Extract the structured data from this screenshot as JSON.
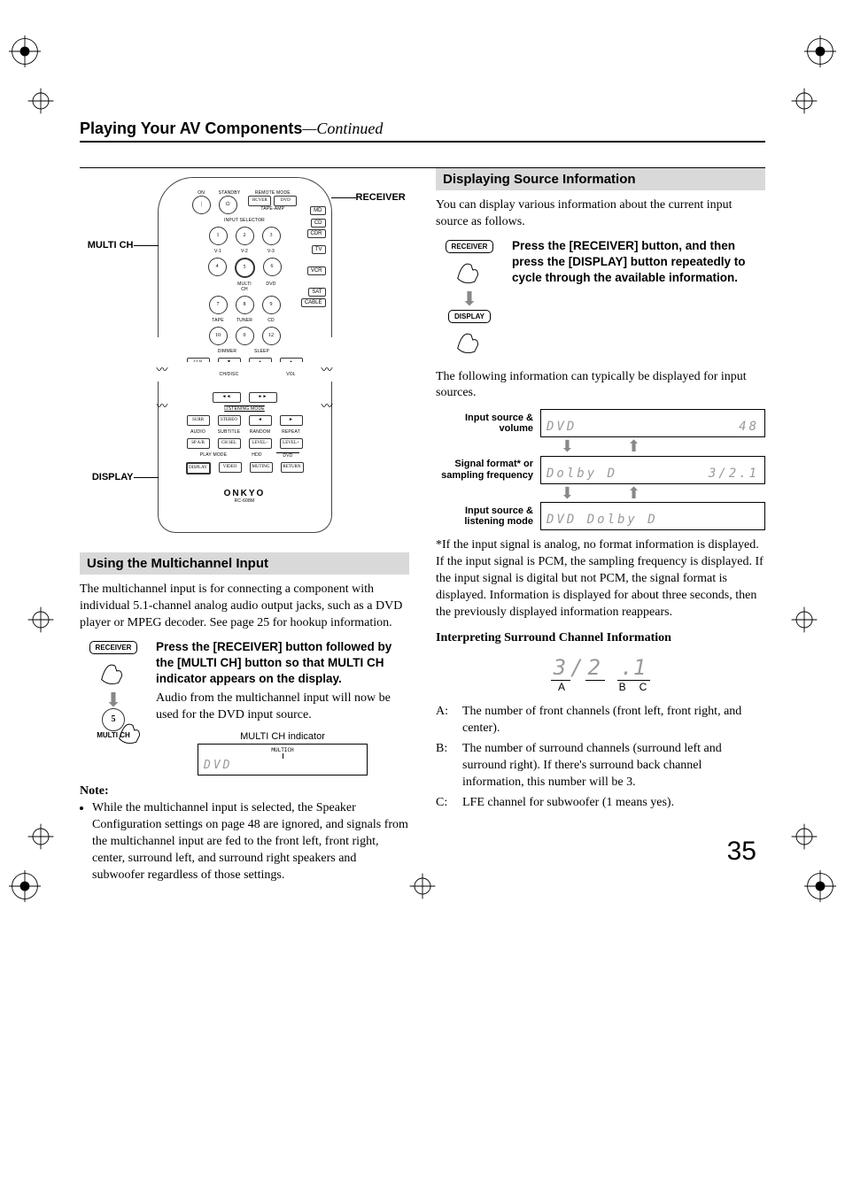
{
  "header": {
    "title": "Playing Your AV Components",
    "continued": "—Continued"
  },
  "remote": {
    "label_multich": "MULTI CH",
    "label_display": "DISPLAY",
    "label_receiver": "RECEIVER",
    "rows": {
      "on": "ON",
      "standby": "STANDBY",
      "remote_mode": "REMOTE MODE",
      "tape_amp": "TAPE-AMP",
      "input_selector": "INPUT SELECTOR",
      "v1": "V-1",
      "v2": "V-2",
      "v3": "V-3",
      "multich": "MULTI CH",
      "dvd": "DVD",
      "tape": "TAPE",
      "tuner": "TUNER",
      "cd": "CD",
      "n1": "1",
      "n2": "2",
      "n3": "3",
      "n4": "4",
      "n5": "5",
      "n6": "6",
      "n7": "7",
      "n8": "8",
      "n9": "9",
      "n10": "10",
      "n0": "0",
      "n12": "12",
      "dimmer": "DIMMER",
      "sleep": "SLEEP",
      "clr": "CLR",
      "chdsk": "CH/DISC",
      "vol": "VOL",
      "listening": "LISTENING MODE",
      "surr": "SURR",
      "stereo": "STEREO",
      "audio": "AUDIO",
      "subtitle": "SUBTITLE",
      "random": "RANDOM",
      "repeat": "REPEAT",
      "spab": "SP A/B",
      "chsel": "CH SEL",
      "level_m": "LEVEL–",
      "level_p": "LEVEL+",
      "playmode": "PLAY MODE",
      "hdd": "HDD",
      "dvd2": "DVD",
      "display_b": "DISPLAY",
      "video": "VIDEO",
      "muting": "MUTING",
      "return": "RETURN",
      "brand": "ONKYO",
      "model": "RC-608M"
    },
    "side": {
      "md": "MD",
      "cd": "CD",
      "cdr": "CDR",
      "tv": "TV",
      "vcr": "VCR",
      "sat": "SAT",
      "cable": "CABLE",
      "rcver": "RCVER",
      "dvd": "DVD"
    }
  },
  "left": {
    "heading": "Using the Multichannel Input",
    "p1": "The multichannel input is for connecting a component with individual 5.1-channel analog audio output jacks, such as a DVD player or MPEG decoder. See page 25 for hookup information.",
    "step_bold": "Press the [RECEIVER] button followed by the [MULTI CH] button so that MULTI CH indicator appears on the display.",
    "step_text": "Audio from the multichannel input will now be used for the DVD input source.",
    "indicator_label": "MULTI CH indicator",
    "lcd_small": "MULTICH",
    "lcd_text": "DVD",
    "receiver_pill": "RECEIVER",
    "btn5": "5",
    "btn5_label": "MULTI CH",
    "note_label": "Note:",
    "note_text": "While the multichannel input is selected, the Speaker Configuration settings on page 48 are ignored, and signals from the multichannel input are fed to the front left, front right, center, surround left, and surround right speakers and subwoofer regardless of those settings."
  },
  "right": {
    "heading": "Displaying Source Information",
    "p1": "You can display various information about the current input source as follows.",
    "step_bold": "Press the [RECEIVER] button, and then press the [DISPLAY] button repeatedly to cycle through the available information.",
    "receiver_pill": "RECEIVER",
    "display_pill": "DISPLAY",
    "p2": "The following information can typically be displayed for input sources.",
    "rows": {
      "r1_label": "Input source & volume",
      "r1_left": "DVD",
      "r1_right": "48",
      "r2_label": "Signal format* or sampling frequency",
      "r2_left": "Dolby D",
      "r2_right": " 3/2.1",
      "r3_label": "Input source & listening mode",
      "r3_left": "DVD Dolby D",
      "r3_right": ""
    },
    "p3": "*If the input signal is analog, no format information is displayed. If the input signal is PCM, the sampling frequency is displayed. If the input signal is digital but not PCM, the signal format is displayed. Information is displayed for about three seconds, then the previously displayed information reappears.",
    "interp_heading": "Interpreting Surround Channel Information",
    "fig": {
      "a": "3",
      "slash": "/",
      "b": "2",
      "dot": ".",
      "c": "1",
      "la": "A",
      "lb": "B",
      "lc": "C"
    },
    "defs": {
      "a": "The number of front channels (front left, front right, and center).",
      "b": "The number of surround channels (surround left and surround right). If there's surround back channel information, this number will be 3.",
      "c": "LFE channel for subwoofer (1 means yes)."
    }
  },
  "page_number": "35"
}
